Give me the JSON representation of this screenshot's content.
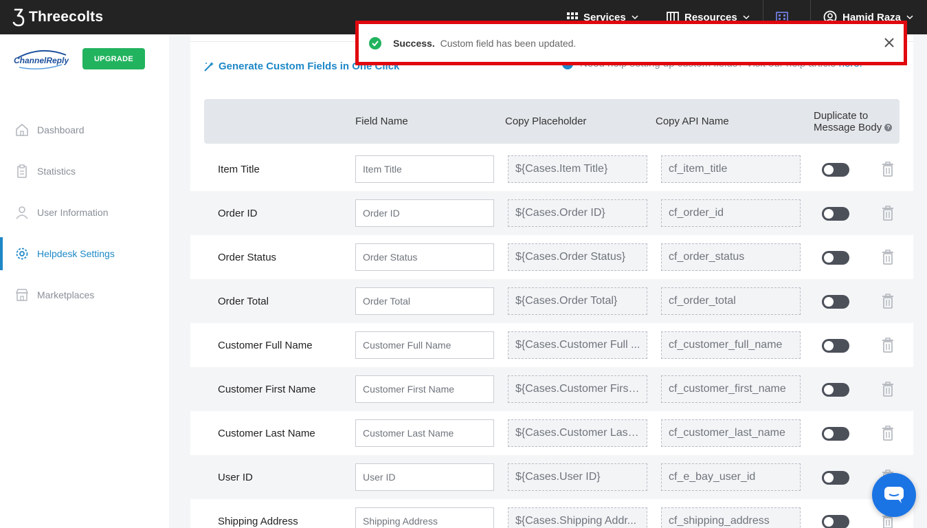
{
  "app": {
    "brand": "Threecolts"
  },
  "topnav": {
    "services": "Services",
    "resources": "Resources",
    "user": "Hamid Raza"
  },
  "sidebar": {
    "upgrade": "UPGRADE",
    "logo_text": "ChannelReply",
    "items": [
      {
        "label": "Dashboard",
        "icon": "home-icon"
      },
      {
        "label": "Statistics",
        "icon": "clipboard-icon"
      },
      {
        "label": "User Information",
        "icon": "user-icon"
      },
      {
        "label": "Helpdesk Settings",
        "icon": "gear-icon",
        "active": true
      },
      {
        "label": "Marketplaces",
        "icon": "store-icon"
      }
    ]
  },
  "main": {
    "generate_link": "Generate Custom Fields in One Click",
    "help_text": "Need help setting up custom fields? Visit our help article",
    "help_link": "here.",
    "headers": {
      "field_name": "Field Name",
      "copy_placeholder": "Copy Placeholder",
      "copy_api": "Copy API Name",
      "duplicate_line1": "Duplicate to",
      "duplicate_line2": "Message Body"
    },
    "rows": [
      {
        "label": "Item Title",
        "input": "Item Title",
        "placeholder": "${Cases.Item Title}",
        "api": "cf_item_title"
      },
      {
        "label": "Order ID",
        "input": "Order ID",
        "placeholder": "${Cases.Order ID}",
        "api": "cf_order_id"
      },
      {
        "label": "Order Status",
        "input": "Order Status",
        "placeholder": "${Cases.Order Status}",
        "api": "cf_order_status"
      },
      {
        "label": "Order Total",
        "input": "Order Total",
        "placeholder": "${Cases.Order Total}",
        "api": "cf_order_total"
      },
      {
        "label": "Customer Full Name",
        "input": "Customer Full Name",
        "placeholder": "${Cases.Customer Full ...",
        "api": "cf_customer_full_name"
      },
      {
        "label": "Customer First Name",
        "input": "Customer First Name",
        "placeholder": "${Cases.Customer First ...",
        "api": "cf_customer_first_name"
      },
      {
        "label": "Customer Last Name",
        "input": "Customer Last Name",
        "placeholder": "${Cases.Customer Last ...",
        "api": "cf_customer_last_name"
      },
      {
        "label": "User ID",
        "input": "User ID",
        "placeholder": "${Cases.User ID}",
        "api": "cf_e_bay_user_id"
      },
      {
        "label": "Shipping Address",
        "input": "Shipping Address",
        "placeholder": "${Cases.Shipping Addr...",
        "api": "cf_shipping_address"
      }
    ]
  },
  "toast": {
    "title": "Success.",
    "message": "Custom field has been updated."
  },
  "colors": {
    "accent": "#1e88c7",
    "success": "#22b35e",
    "toast_border": "#e0080e",
    "chat": "#1b74e4"
  }
}
